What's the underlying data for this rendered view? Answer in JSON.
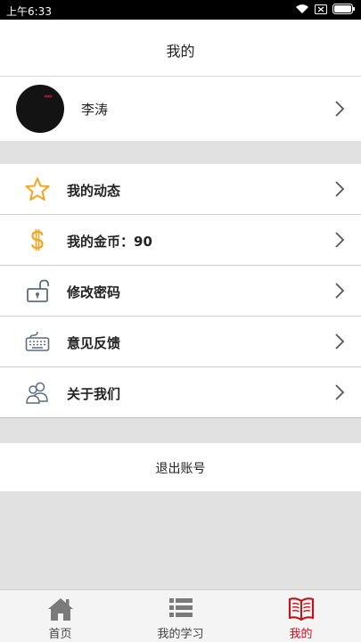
{
  "status_bar": {
    "time": "上午6:33"
  },
  "header": {
    "title": "我的"
  },
  "profile": {
    "name": "李涛"
  },
  "menu": [
    {
      "label": "我的动态",
      "icon": "star-icon"
    },
    {
      "label": "我的金币：90",
      "icon": "dollar-icon"
    },
    {
      "label": "修改密码",
      "icon": "unlock-icon"
    },
    {
      "label": "意见反馈",
      "icon": "keyboard-icon"
    },
    {
      "label": "关于我们",
      "icon": "users-icon"
    }
  ],
  "logout": {
    "label": "退出账号"
  },
  "tabbar": [
    {
      "label": "首页",
      "icon": "home-icon",
      "active": false
    },
    {
      "label": "我的学习",
      "icon": "list-icon",
      "active": false
    },
    {
      "label": "我的",
      "icon": "book-icon",
      "active": true
    }
  ],
  "colors": {
    "accent": "#c0141c",
    "star": "#f2a623",
    "dollar": "#f2a623",
    "icon_gray": "#5b6f80"
  }
}
